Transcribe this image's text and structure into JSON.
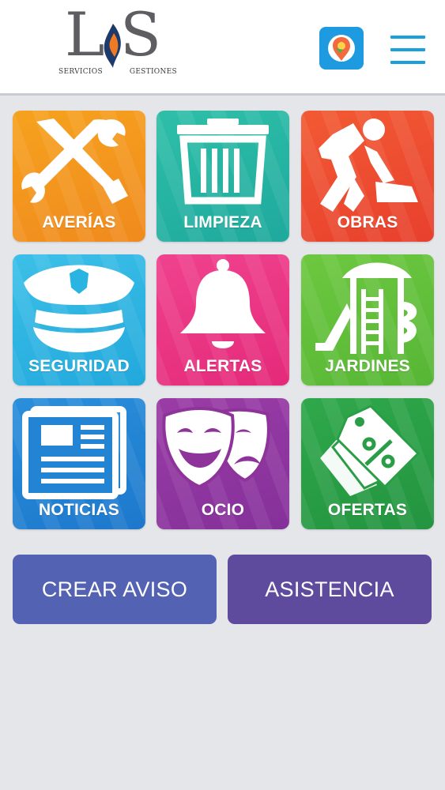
{
  "header": {
    "logo_letters": [
      "L",
      "S"
    ],
    "logo_left_word": "SERVICIOS",
    "logo_right_word": "GESTIONES",
    "app_badge_icon": "map-pin-icon",
    "menu_icon": "hamburger-menu-icon"
  },
  "tiles": [
    {
      "label": "AVERÍAS",
      "icon": "tools-icon",
      "color_from": "#f6a21e",
      "color_to": "#f08a1e"
    },
    {
      "label": "LIMPIEZA",
      "icon": "trash-bin-icon",
      "color_from": "#2ebfa8",
      "color_to": "#1fa99d"
    },
    {
      "label": "OBRAS",
      "icon": "worker-shovel-icon",
      "color_from": "#f25a33",
      "color_to": "#e8402d"
    },
    {
      "label": "SEGURIDAD",
      "icon": "police-cap-icon",
      "color_from": "#3cc0e8",
      "color_to": "#22a8dc"
    },
    {
      "label": "ALERTAS",
      "icon": "bell-icon",
      "color_from": "#f0428e",
      "color_to": "#e42a7a"
    },
    {
      "label": "JARDINES",
      "icon": "playground-icon",
      "color_from": "#6dc83f",
      "color_to": "#56b635"
    },
    {
      "label": "NOTICIAS",
      "icon": "newspaper-icon",
      "color_from": "#2a8fdb",
      "color_to": "#1d78cc"
    },
    {
      "label": "OCIO",
      "icon": "theater-masks-icon",
      "color_from": "#9a3ca6",
      "color_to": "#85309a"
    },
    {
      "label": "OFERTAS",
      "icon": "discount-tags-icon",
      "color_from": "#2fa84a",
      "color_to": "#239440"
    }
  ],
  "actions": {
    "create_label": "CREAR AVISO",
    "create_color": "#5362b2",
    "assist_label": "ASISTENCIA",
    "assist_color": "#5e4b9e"
  }
}
